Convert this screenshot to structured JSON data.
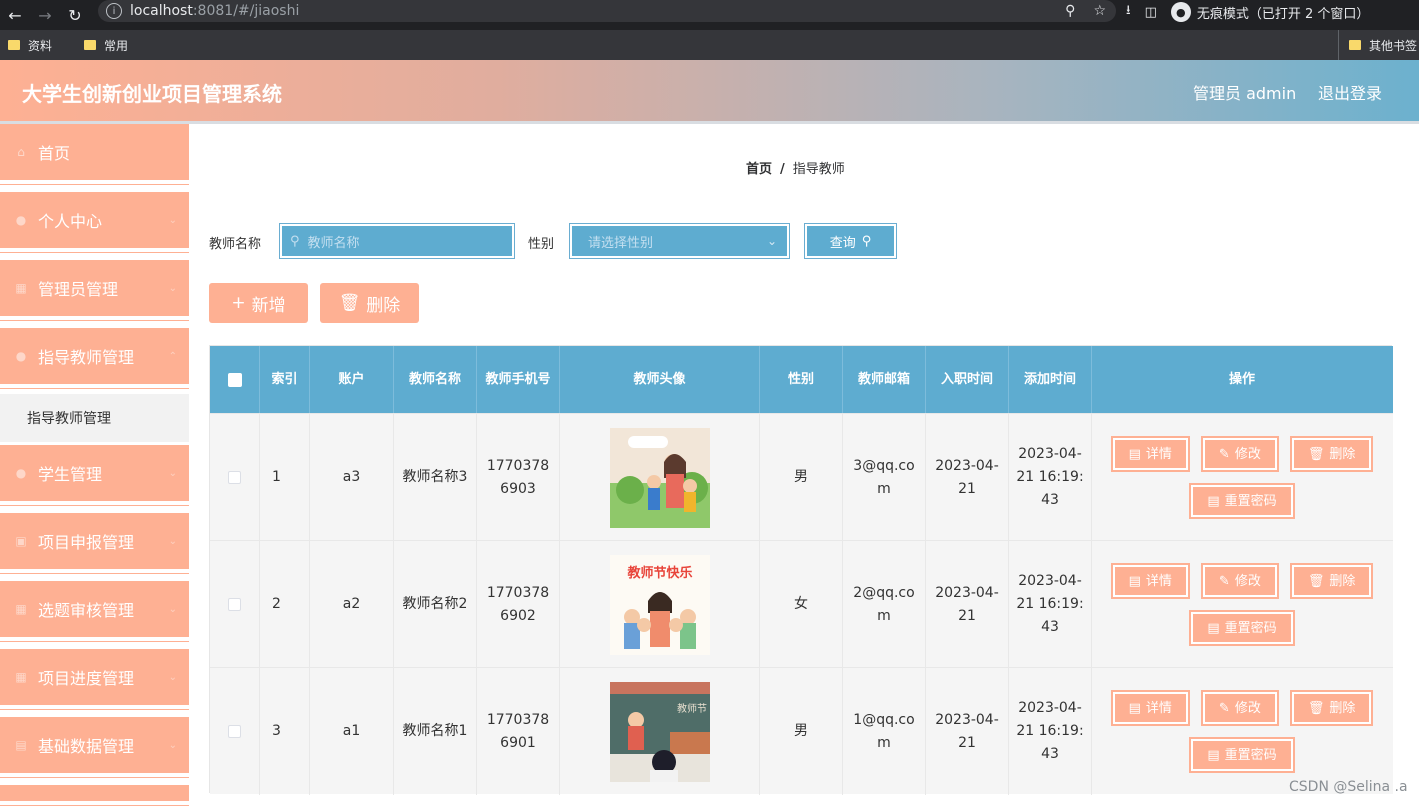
{
  "browser": {
    "url_host": "localhost",
    "url_path": ":8081/#/jiaoshi",
    "incognito_label": "无痕模式（已打开 2 个窗口）",
    "bookmarks": [
      "资料",
      "常用"
    ],
    "other_bookmarks": "其他书签"
  },
  "header": {
    "title": "大学生创新创业项目管理系统",
    "user": "管理员 admin",
    "logout": "退出登录"
  },
  "sidebar": {
    "items": [
      {
        "label": "首页",
        "icon": "home-icon"
      },
      {
        "label": "个人中心",
        "icon": "user-icon"
      },
      {
        "label": "管理员管理",
        "icon": "grid-icon"
      },
      {
        "label": "指导教师管理",
        "icon": "user-icon"
      },
      {
        "label": "学生管理",
        "icon": "user-icon"
      },
      {
        "label": "项目申报管理",
        "icon": "monitor-icon"
      },
      {
        "label": "选题审核管理",
        "icon": "grid-icon"
      },
      {
        "label": "项目进度管理",
        "icon": "grid-icon"
      },
      {
        "label": "基础数据管理",
        "icon": "table-icon"
      }
    ],
    "active_submenu": "指导教师管理"
  },
  "breadcrumb": {
    "home": "首页",
    "separator": "/",
    "current": "指导教师"
  },
  "search": {
    "name_label": "教师名称",
    "name_placeholder": "教师名称",
    "gender_label": "性别",
    "gender_placeholder": "请选择性别",
    "query_label": "查询"
  },
  "actions": {
    "add": "新增",
    "delete": "删除"
  },
  "table": {
    "columns": [
      "索引",
      "账户",
      "教师名称",
      "教师手机号",
      "教师头像",
      "性别",
      "教师邮箱",
      "入职时间",
      "添加时间",
      "操作"
    ],
    "rows": [
      {
        "index": "1",
        "account": "a3",
        "name": "教师名称3",
        "phone": "17703786903",
        "gender": "男",
        "email": "3@qq.com",
        "hire_date": "2023-04-21",
        "added": "2023-04-21 16:19:43"
      },
      {
        "index": "2",
        "account": "a2",
        "name": "教师名称2",
        "phone": "17703786902",
        "gender": "女",
        "email": "2@qq.com",
        "hire_date": "2023-04-21",
        "added": "2023-04-21 16:19:43"
      },
      {
        "index": "3",
        "account": "a1",
        "name": "教师名称1",
        "phone": "17703786901",
        "gender": "男",
        "email": "1@qq.com",
        "hire_date": "2023-04-21",
        "added": "2023-04-21 16:19:43"
      }
    ],
    "row_actions": {
      "detail": "详情",
      "edit": "修改",
      "delete": "删除",
      "reset": "重置密码"
    }
  },
  "avatar_texts": [
    "教师节快乐",
    "教师节"
  ],
  "watermark": "CSDN @Selina .a",
  "colors": {
    "accent": "#feb093",
    "primary_blue": "#5eacd0"
  }
}
